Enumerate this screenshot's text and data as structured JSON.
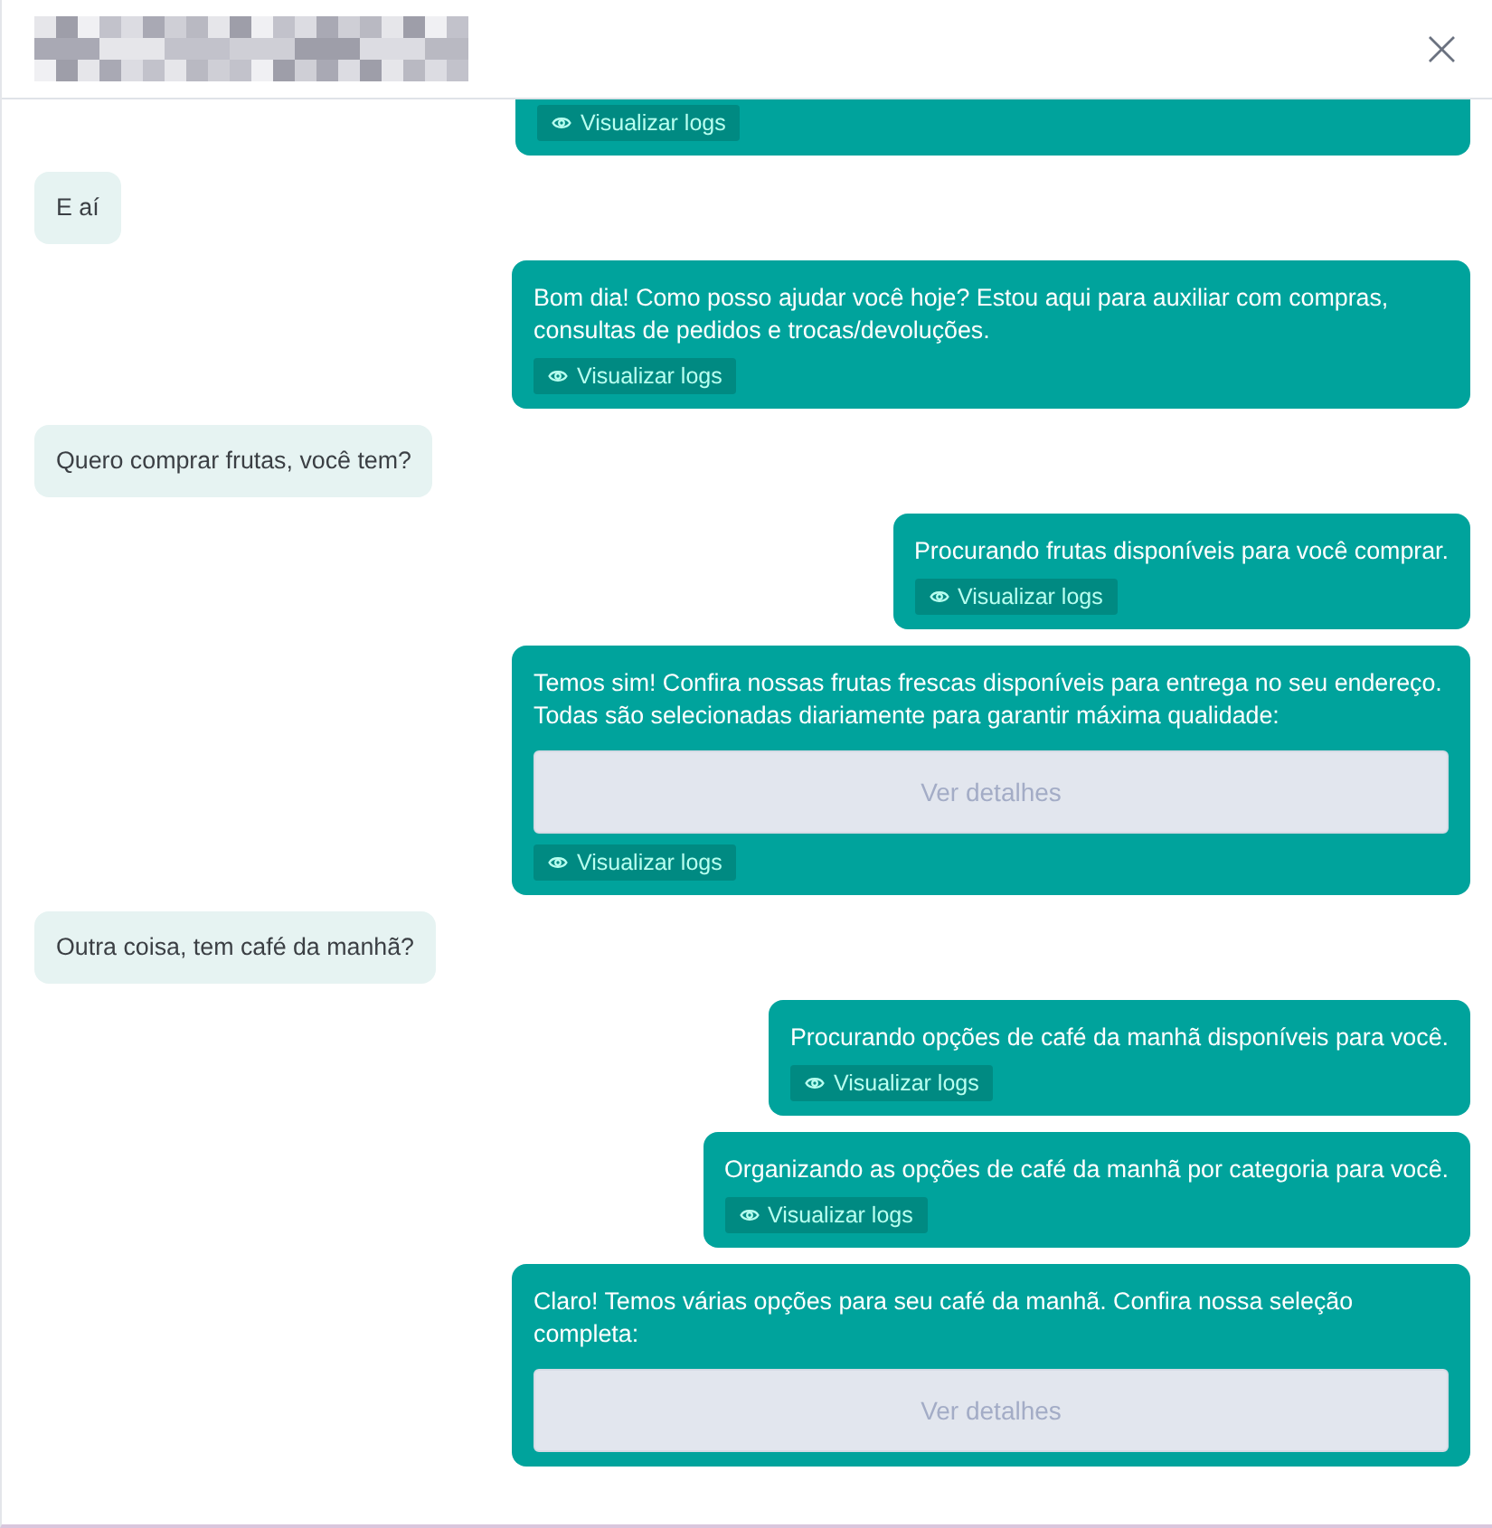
{
  "header": {
    "close_label": "×"
  },
  "messages": [
    {
      "kind": "bot_cut",
      "logs_button": "Visualizar logs"
    },
    {
      "kind": "user",
      "text": "E aí"
    },
    {
      "kind": "bot",
      "text": "Bom dia! Como posso ajudar você hoje? Estou aqui para auxiliar com compras, consultas de pedidos e trocas/devoluções.",
      "logs_button": "Visualizar logs"
    },
    {
      "kind": "user",
      "text": "Quero comprar frutas, você tem?"
    },
    {
      "kind": "bot",
      "text": "Procurando frutas disponíveis para você comprar.",
      "logs_button": "Visualizar logs"
    },
    {
      "kind": "bot",
      "text": "Temos sim! Confira nossas frutas frescas disponíveis para entrega no seu endereço. Todas são selecionadas diariamente para garantir máxima qualidade:",
      "details_button": "Ver detalhes",
      "logs_button": "Visualizar logs"
    },
    {
      "kind": "user",
      "text": "Outra coisa, tem café da manhã?"
    },
    {
      "kind": "bot",
      "text": "Procurando opções de café da manhã disponíveis para você.",
      "logs_button": "Visualizar logs"
    },
    {
      "kind": "bot",
      "text": "Organizando as opções de café da manhã por categoria para você.",
      "logs_button": "Visualizar logs"
    },
    {
      "kind": "bot",
      "text": "Claro! Temos várias opções para seu café da manhã. Confira nossa seleção completa:",
      "details_button": "Ver detalhes"
    }
  ]
}
